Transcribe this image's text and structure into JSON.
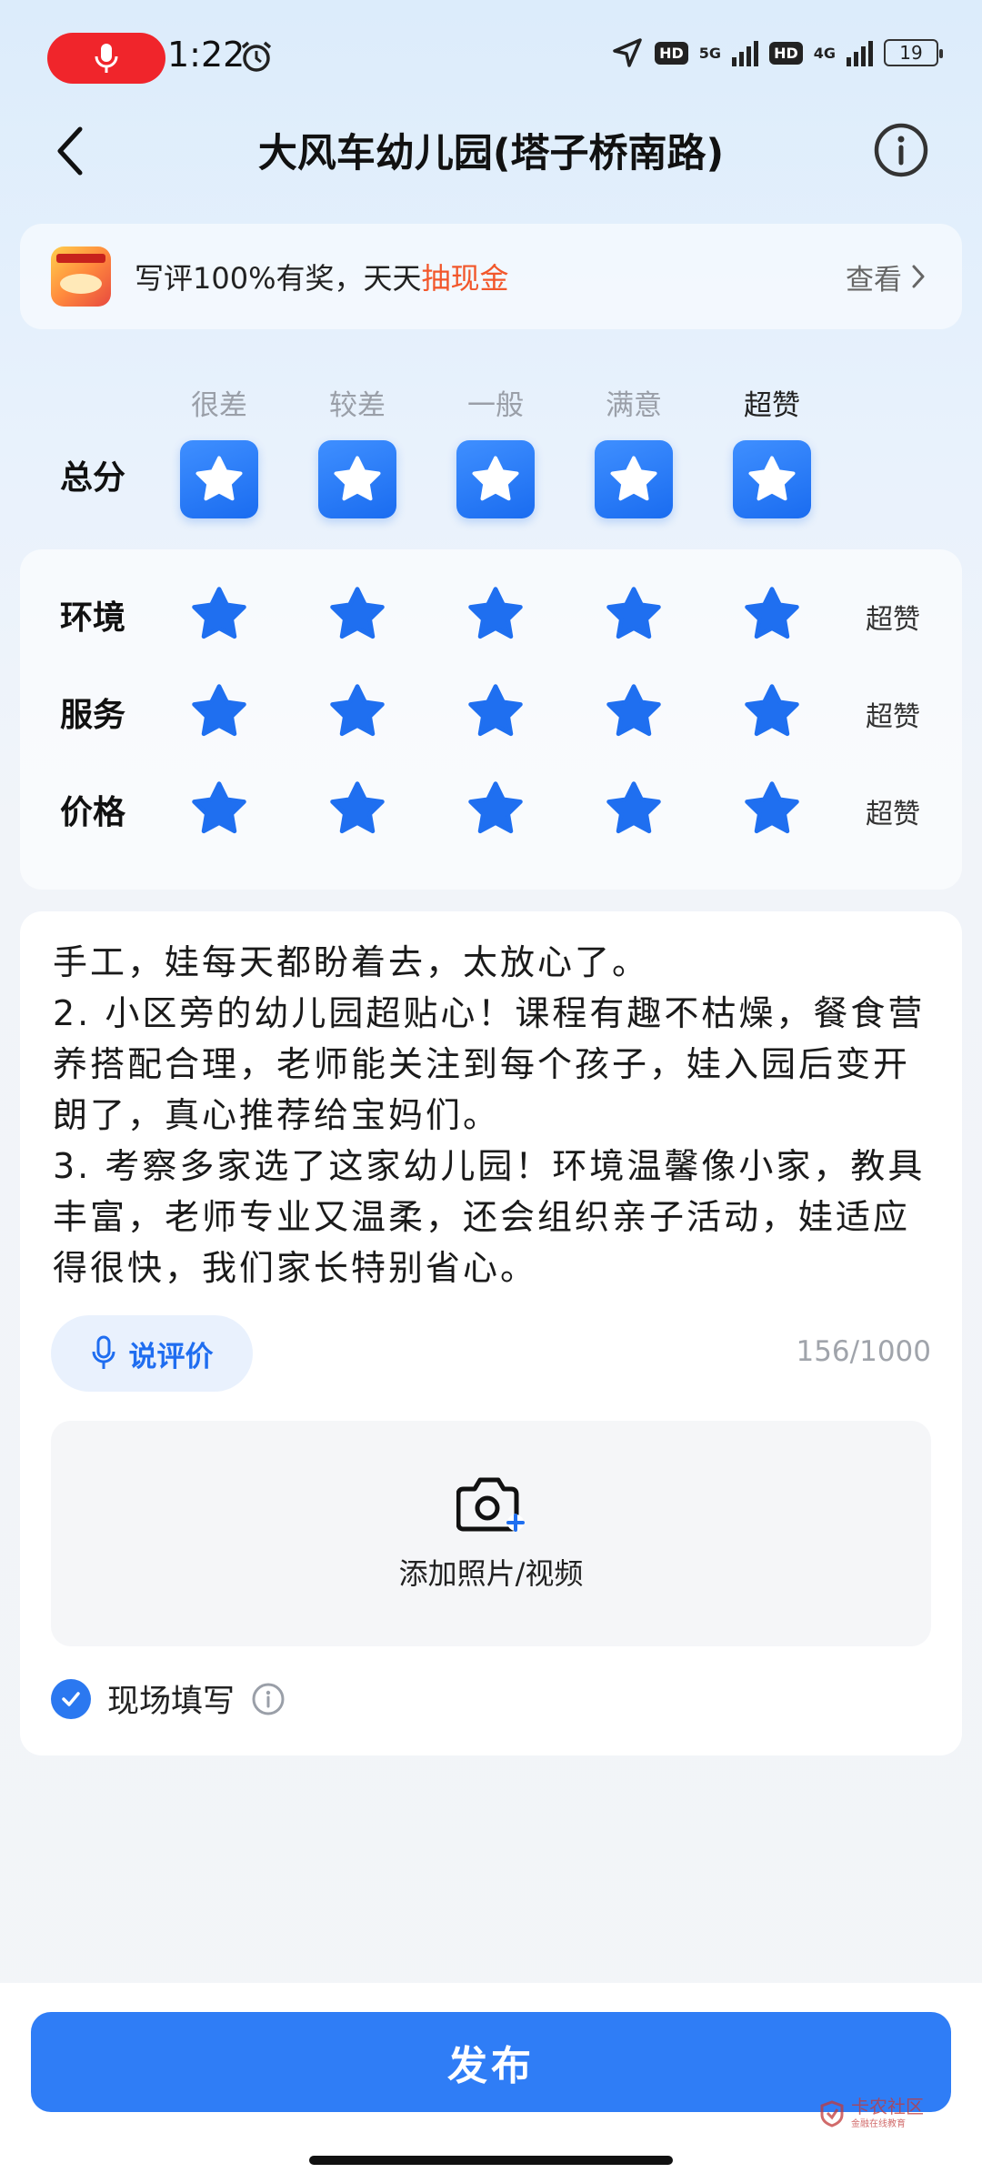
{
  "status_bar": {
    "time": "1:22",
    "network_badge_1": "HD",
    "network_1": "5G",
    "network_badge_2": "HD",
    "network_2": "4G",
    "battery": "19"
  },
  "header": {
    "title": "大风车幼儿园(塔子桥南路)"
  },
  "promo": {
    "text_prefix": "写评100%有奖，天天",
    "text_highlight": "抽现金",
    "link_label": "查看"
  },
  "rating": {
    "level_labels": [
      "很差",
      "较差",
      "一般",
      "满意",
      "超赞"
    ],
    "overall_label": "总分",
    "overall_score": 5,
    "categories": [
      {
        "label": "环境",
        "score": 5,
        "value": "超赞"
      },
      {
        "label": "服务",
        "score": 5,
        "value": "超赞"
      },
      {
        "label": "价格",
        "score": 5,
        "value": "超赞"
      }
    ]
  },
  "review": {
    "lines": [
      "手工，娃每天都盼着去，太放心了。",
      "2. 小区旁的幼儿园超贴心！课程有趣不枯燥，餐食营养搭配合理，老师能关注到每个孩子，娃入园后变开朗了，真心推荐给宝妈们。",
      "3. 考察多家选了这家幼儿园！环境温馨像小家，教具丰富，老师专业又温柔，还会组织亲子活动，娃适应得很快，我们家长特别省心。"
    ],
    "voice_label": "说评价",
    "counter": "156/1000",
    "upload_label": "添加照片/视频",
    "onsite_label": "现场填写",
    "onsite_checked": true
  },
  "footer": {
    "publish_label": "发布",
    "watermark": "卡农社区",
    "watermark_sub": "金融在线教育"
  },
  "colors": {
    "accent": "#2f7df6",
    "star": "#1f6ff0",
    "highlight": "#f2572b"
  }
}
